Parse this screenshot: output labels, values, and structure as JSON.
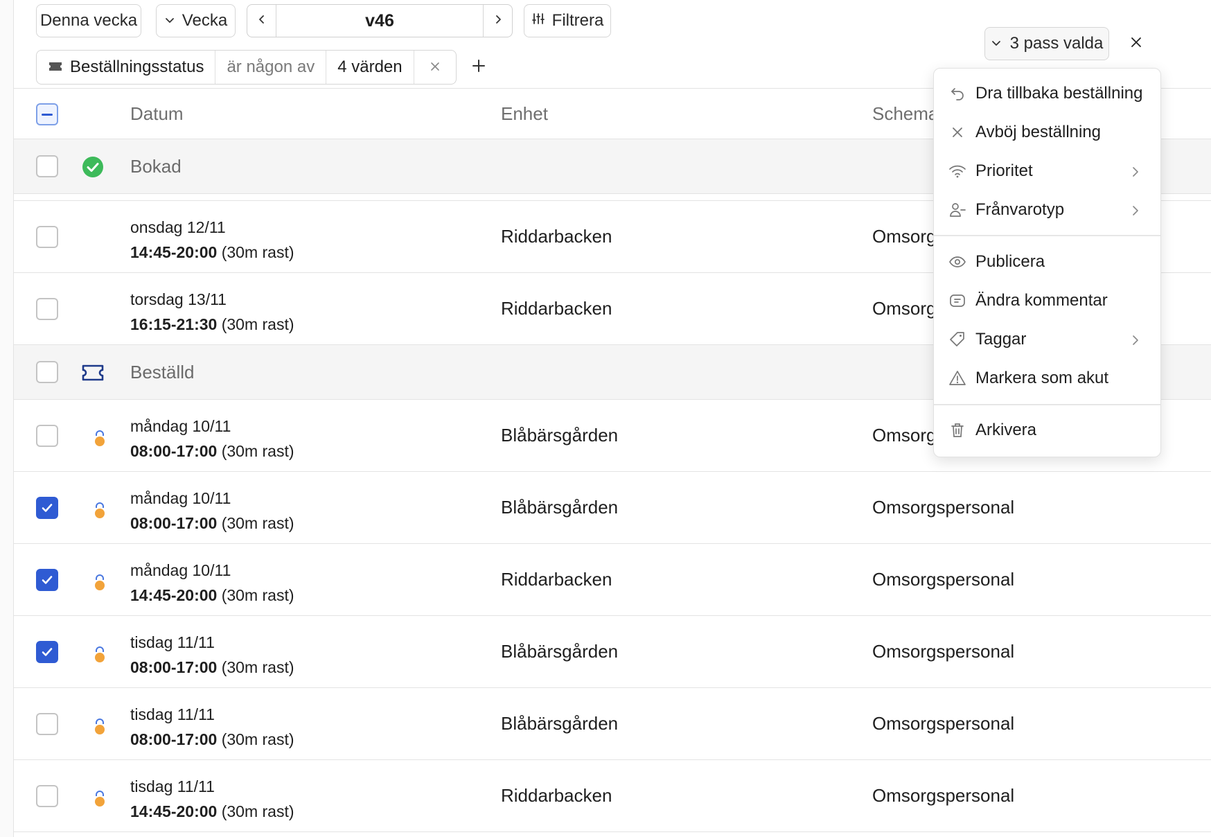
{
  "toolbar": {
    "this_week_label": "Denna vecka",
    "period_label": "Vecka",
    "week_value": "v46",
    "filter_label": "Filtrera",
    "selection_label": "3 pass valda"
  },
  "filter_chip": {
    "field": "Beställningsstatus",
    "operator": "är någon av",
    "value": "4 värden"
  },
  "table": {
    "columns": {
      "date": "Datum",
      "unit": "Enhet",
      "schema": "Schema"
    },
    "groups": [
      {
        "label": "Bokad",
        "status_icon": "check-circle-icon",
        "rows": [
          {
            "date": "onsdag 12/11",
            "time": "14:45-20:00",
            "break": "(30m rast)",
            "unit": "Riddarbacken",
            "schema": "Omsorg",
            "checked": false
          },
          {
            "date": "torsdag 13/11",
            "time": "16:15-21:30",
            "break": "(30m rast)",
            "unit": "Riddarbacken",
            "schema": "Omsorg",
            "checked": false
          }
        ]
      },
      {
        "label": "Beställd",
        "status_icon": "ticket-icon",
        "rows": [
          {
            "date": "måndag 10/11",
            "time": "08:00-17:00",
            "break": "(30m rast)",
            "unit": "Blåbärsgården",
            "schema": "Omsorg",
            "checked": false
          },
          {
            "date": "måndag 10/11",
            "time": "08:00-17:00",
            "break": "(30m rast)",
            "unit": "Blåbärsgården",
            "schema": "Omsorgspersonal",
            "checked": true
          },
          {
            "date": "måndag 10/11",
            "time": "14:45-20:00",
            "break": "(30m rast)",
            "unit": "Riddarbacken",
            "schema": "Omsorgspersonal",
            "checked": true
          },
          {
            "date": "tisdag 11/11",
            "time": "08:00-17:00",
            "break": "(30m rast)",
            "unit": "Blåbärsgården",
            "schema": "Omsorgspersonal",
            "checked": true
          },
          {
            "date": "tisdag 11/11",
            "time": "08:00-17:00",
            "break": "(30m rast)",
            "unit": "Blåbärsgården",
            "schema": "Omsorgspersonal",
            "checked": false
          },
          {
            "date": "tisdag 11/11",
            "time": "14:45-20:00",
            "break": "(30m rast)",
            "unit": "Riddarbacken",
            "schema": "Omsorgspersonal",
            "checked": false
          }
        ]
      }
    ]
  },
  "menu": {
    "items": [
      {
        "label": "Dra tillbaka beställning",
        "icon": "undo-icon",
        "submenu": false
      },
      {
        "label": "Avböj beställning",
        "icon": "close-icon",
        "submenu": false
      },
      {
        "label": "Prioritet",
        "icon": "signal-icon",
        "submenu": true
      },
      {
        "label": "Frånvarotyp",
        "icon": "user-minus-icon",
        "submenu": true
      },
      {
        "label": "Publicera",
        "icon": "eye-icon",
        "submenu": false
      },
      {
        "label": "Ändra kommentar",
        "icon": "comment-icon",
        "submenu": false
      },
      {
        "label": "Taggar",
        "icon": "tag-icon",
        "submenu": true
      },
      {
        "label": "Markera som akut",
        "icon": "warning-icon",
        "submenu": false
      },
      {
        "label": "Arkivera",
        "icon": "trash-icon",
        "submenu": false
      }
    ]
  },
  "colors": {
    "accent": "#2f5bd3",
    "booked_green": "#3dba5a",
    "pending_orange": "#f2a33a",
    "pending_blue": "#4a78e0"
  }
}
